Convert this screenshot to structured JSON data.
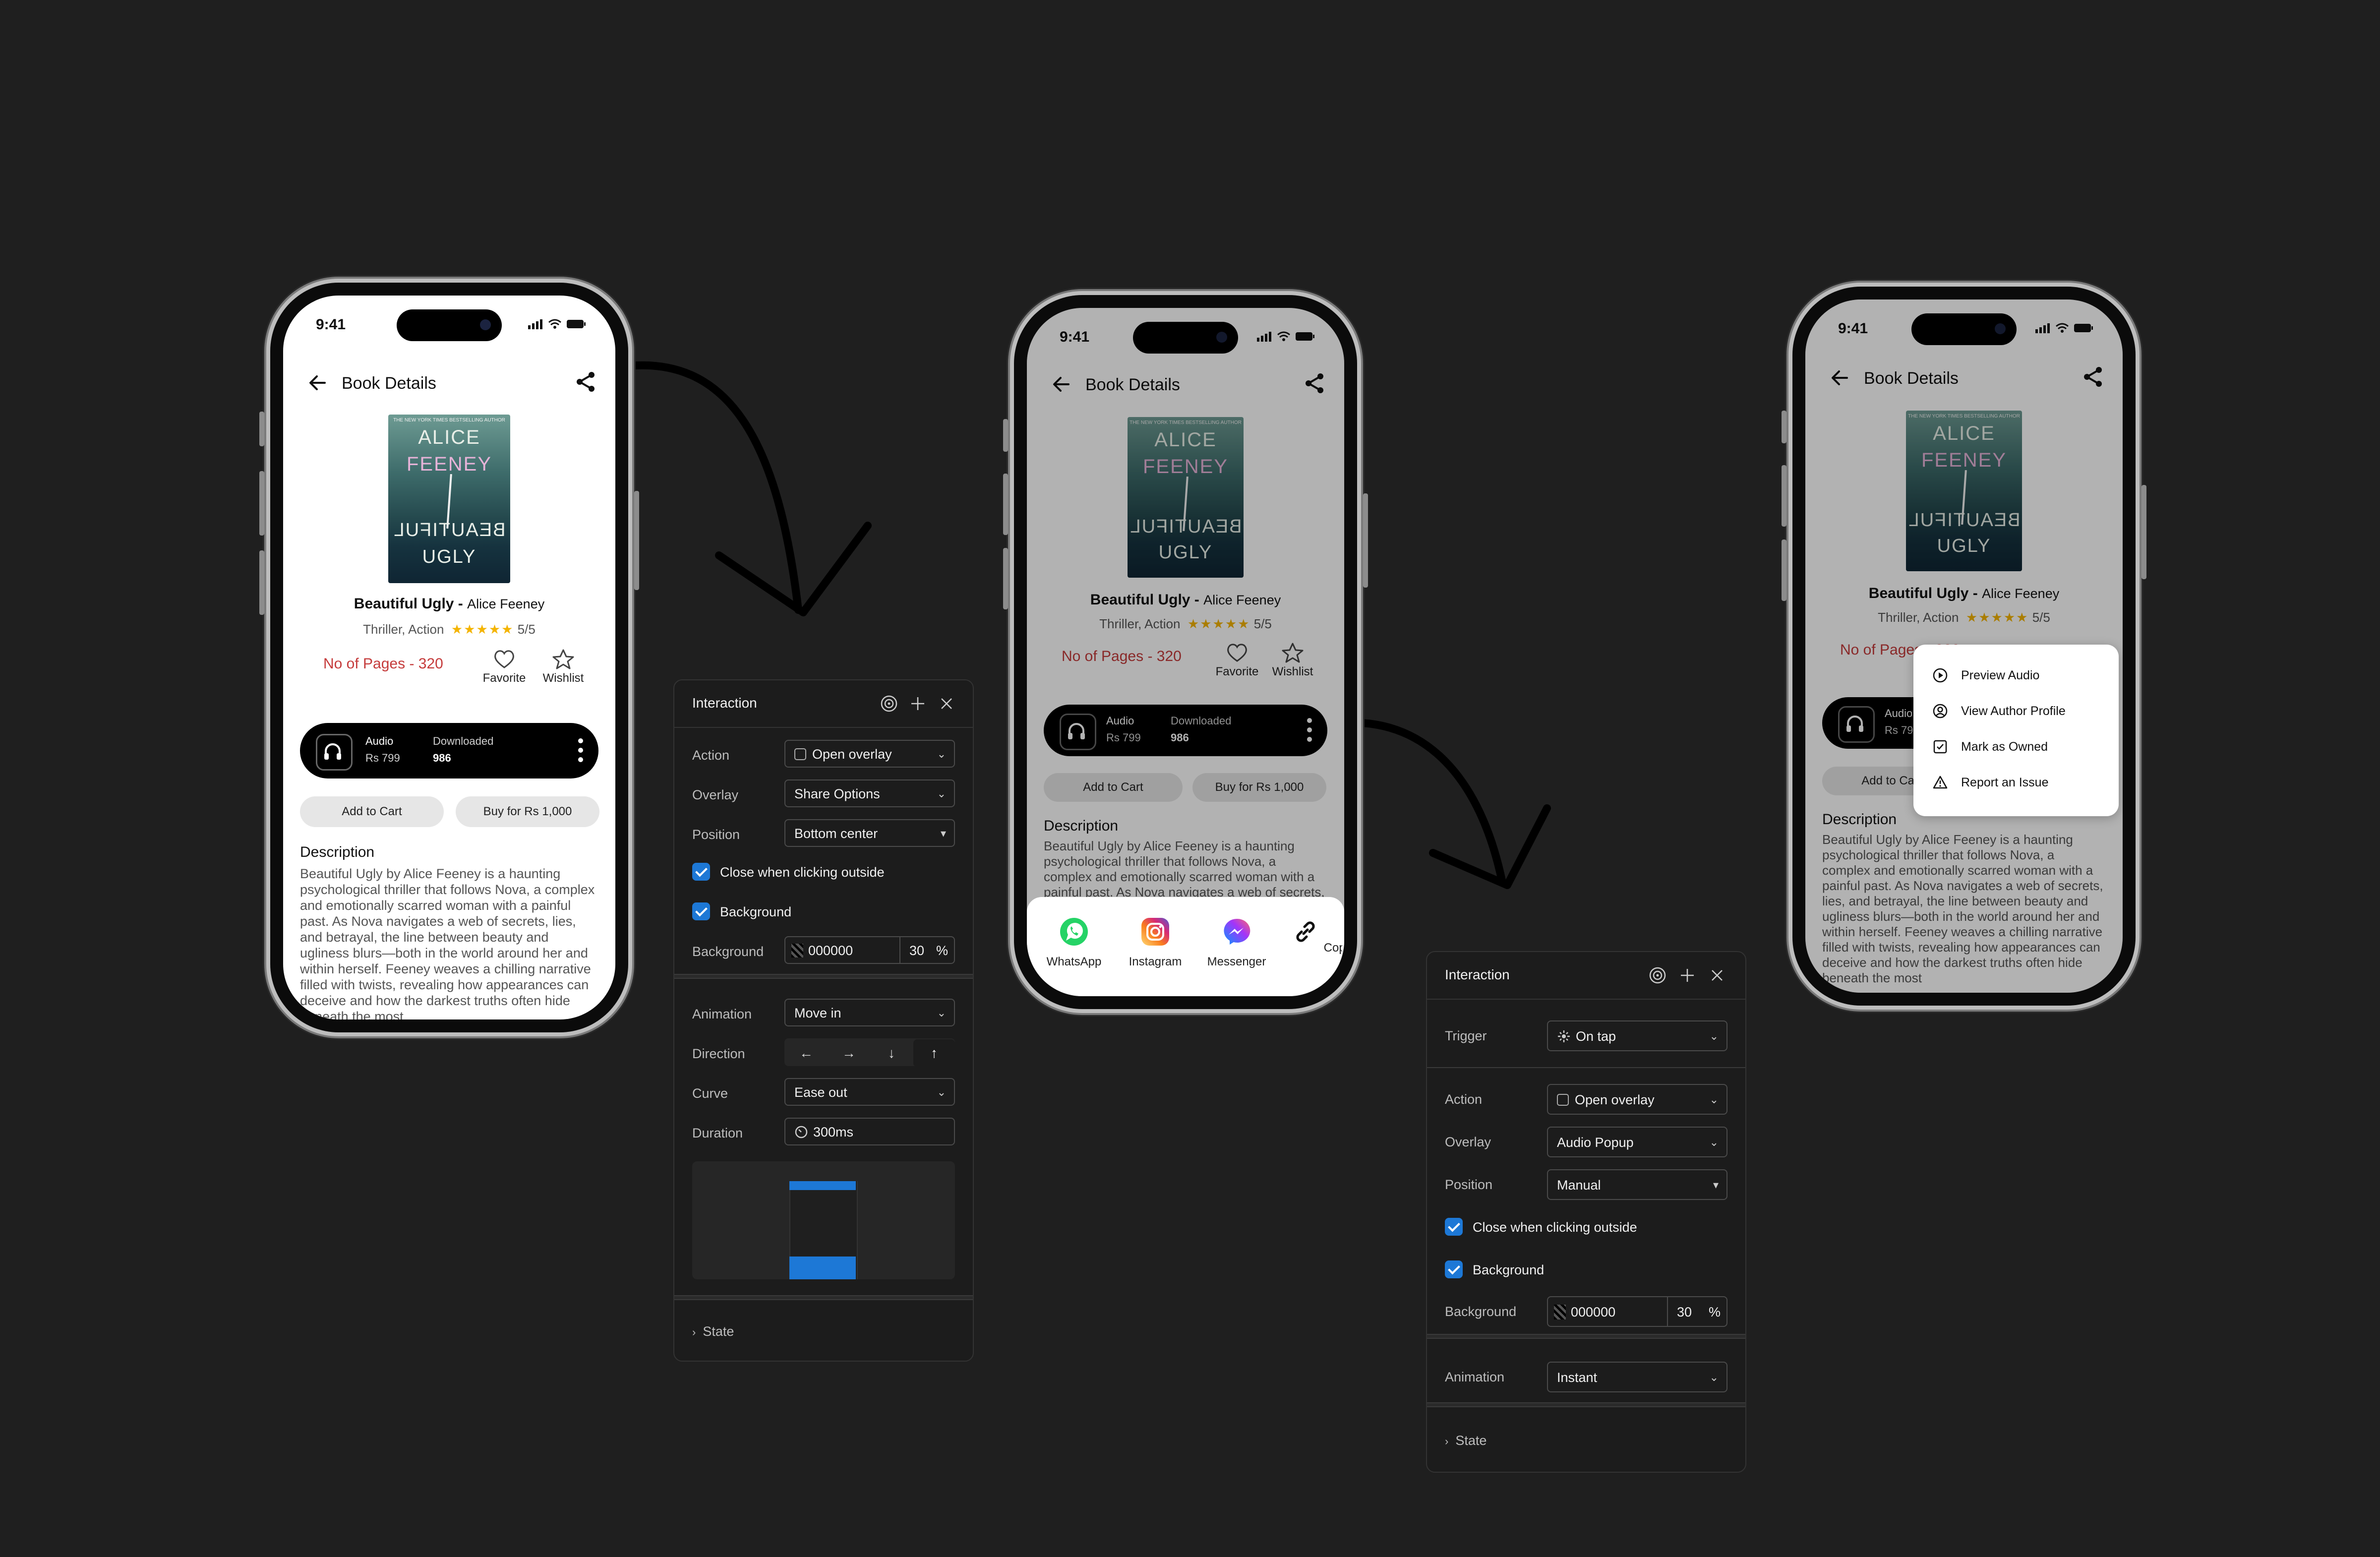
{
  "phone": {
    "time": "9:41",
    "title": "Book Details",
    "cover": {
      "top_text": "THE NEW YORK TIMES BESTSELLING AUTHOR",
      "line1": "ALICE",
      "line2": "FEENEY",
      "line3": "BEAUTIFUL",
      "line4": "UGLY"
    },
    "book_title": "Beautiful Ugly - ",
    "book_author": "Alice Feeney",
    "genre": "Thriller, Action",
    "stars": "★★★★★",
    "rating": "5/5",
    "pages": "No of Pages - 320",
    "favorite": "Favorite",
    "wishlist": "Wishlist",
    "audio_label": "Audio",
    "audio_price": "Rs 799",
    "downloaded_label": "Downloaded",
    "downloaded_count": "986",
    "add_to_cart": "Add to Cart",
    "buy": "Buy for Rs 1,000",
    "description_title": "Description",
    "description": "Beautiful Ugly by Alice Feeney is a haunting psychological thriller that follows Nova, a complex and emotionally scarred woman with a painful past. As Nova navigates a web of secrets, lies, and betrayal, the line between beauty and ugliness blurs—both in the world around her and within herself. Feeney weaves a chilling narrative filled with twists, revealing how appearances can deceive and how the darkest truths often hide beneath the most"
  },
  "share_sheet": {
    "items": [
      "WhatsApp",
      "Instagram",
      "Messenger",
      "Copy Link"
    ]
  },
  "popup_menu": {
    "items": [
      "Preview Audio",
      "View Author Profile",
      "Mark as Owned",
      "Report an Issue"
    ]
  },
  "panel1": {
    "title": "Interaction",
    "action_label": "Action",
    "action_value": "Open overlay",
    "overlay_label": "Overlay",
    "overlay_value": "Share Options",
    "position_label": "Position",
    "position_value": "Bottom center",
    "close_outside": "Close when clicking outside",
    "background_check": "Background",
    "background_label": "Background",
    "background_hex": "000000",
    "background_opacity": "30",
    "percent": "%",
    "animation_label": "Animation",
    "animation_value": "Move in",
    "direction_label": "Direction",
    "direction_arrows": [
      "←",
      "→",
      "↓",
      "↑"
    ],
    "curve_label": "Curve",
    "curve_value": "Ease out",
    "duration_label": "Duration",
    "duration_value": "300ms",
    "state_label": "State"
  },
  "panel2": {
    "title": "Interaction",
    "trigger_label": "Trigger",
    "trigger_value": "On tap",
    "action_label": "Action",
    "action_value": "Open overlay",
    "overlay_label": "Overlay",
    "overlay_value": "Audio Popup",
    "position_label": "Position",
    "position_value": "Manual",
    "close_outside": "Close when clicking outside",
    "background_check": "Background",
    "background_label": "Background",
    "background_hex": "000000",
    "background_opacity": "30",
    "percent": "%",
    "animation_label": "Animation",
    "animation_value": "Instant",
    "state_label": "State"
  },
  "colors": {
    "page_bg": "#1f1f1f",
    "accent_blue": "#1d78d6",
    "pages_red": "#c53b3b",
    "star_gold": "#f4b400"
  }
}
